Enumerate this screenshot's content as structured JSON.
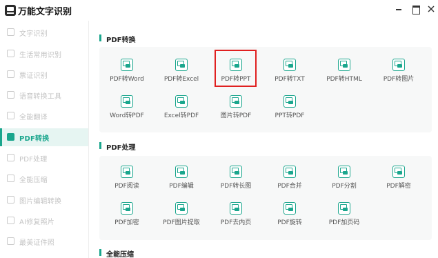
{
  "app": {
    "title": "万能文字识别"
  },
  "window": {
    "minimize": "minimize",
    "maximize": "maximize",
    "close": "close"
  },
  "sidebar": {
    "items": [
      {
        "label": "文字识别",
        "icon": "text-recognize-icon",
        "active": false
      },
      {
        "label": "生活常用识别",
        "icon": "life-recognize-icon",
        "active": false
      },
      {
        "label": "票证识别",
        "icon": "ticket-recognize-icon",
        "active": false
      },
      {
        "label": "语音转换工具",
        "icon": "voice-convert-icon",
        "active": false
      },
      {
        "label": "全能翻译",
        "icon": "translate-icon",
        "active": false
      },
      {
        "label": "PDF转换",
        "icon": "pdf-convert-icon",
        "active": true
      },
      {
        "label": "PDF处理",
        "icon": "pdf-process-icon",
        "active": false
      },
      {
        "label": "全能压缩",
        "icon": "compress-icon",
        "active": false
      },
      {
        "label": "图片编辑转换",
        "icon": "image-edit-icon",
        "active": false
      },
      {
        "label": "AI修复照片",
        "icon": "ai-repair-icon",
        "active": false
      },
      {
        "label": "最美证件照",
        "icon": "id-photo-icon",
        "active": false
      }
    ]
  },
  "sections": {
    "pdf_convert": {
      "title": "PDF转换",
      "tools": [
        "PDF转Word",
        "PDF转Excel",
        "PDF转PPT",
        "PDF转TXT",
        "PDF转HTML",
        "PDF转图片",
        "Word转PDF",
        "Excel转PDF",
        "图片转PDF",
        "PPT转PDF"
      ]
    },
    "pdf_process": {
      "title": "PDF处理",
      "tools": [
        "PDF阅读",
        "PDF编辑",
        "PDF转长图",
        "PDF合并",
        "PDF分割",
        "PDF解密",
        "PDF加密",
        "PDF图片提取",
        "PDF去内页",
        "PDF旋转",
        "PDF加页码"
      ]
    },
    "compress": {
      "title": "全能压缩"
    }
  },
  "colors": {
    "accent": "#1aa68d",
    "highlight": "#e02020"
  }
}
